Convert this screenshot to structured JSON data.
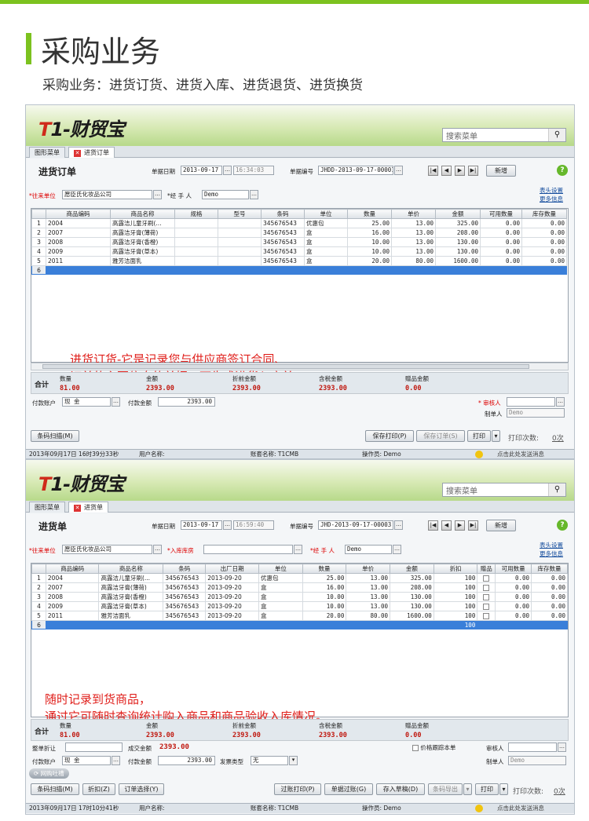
{
  "section": {
    "title": "采购业务",
    "subtitle": "采购业务：进货订货、进货入库、进货退货、进货换货"
  },
  "app": {
    "logo_t": "T",
    "logo_rest": "1-财贸宝",
    "search_placeholder": "搜索菜单",
    "search_icon": "search-icon"
  },
  "order": {
    "tabs": [
      "图形菜单",
      "进货订单"
    ],
    "title": "进货订单",
    "date_label": "单据日期",
    "date": "2013-09-17",
    "time": "16:34:03",
    "no_label": "单据编号",
    "no": "JHDD-2013-09-17-00001",
    "new_btn": "新增",
    "supplier_label": "*往来单位",
    "supplier": "愿臣氏化妆品公司",
    "handler_label": "*经 手 人",
    "handler": "Demo",
    "link1": "表头设置",
    "link2": "更多信息",
    "columns": [
      "",
      "商品编码",
      "商品名称",
      "规格",
      "型号",
      "条码",
      "单位",
      "数量",
      "单价",
      "金额",
      "可用数量",
      "库存数量"
    ],
    "rows": [
      [
        "1",
        "2004",
        "高露洁儿童牙刷(...",
        "",
        "",
        "345676543",
        "优惠包",
        "25.00",
        "13.00",
        "325.00",
        "0.00",
        "0.00"
      ],
      [
        "2",
        "2007",
        "高露洁牙膏(薄荷)",
        "",
        "",
        "345676543",
        "盒",
        "16.00",
        "13.00",
        "208.00",
        "0.00",
        "0.00"
      ],
      [
        "3",
        "2008",
        "高露洁牙膏(香橙)",
        "",
        "",
        "345676543",
        "盒",
        "10.00",
        "13.00",
        "130.00",
        "0.00",
        "0.00"
      ],
      [
        "4",
        "2009",
        "高露洁牙膏(草本)",
        "",
        "",
        "345676543",
        "盒",
        "10.00",
        "13.00",
        "130.00",
        "0.00",
        "0.00"
      ],
      [
        "5",
        "2011",
        "雅芳洁面乳",
        "",
        "",
        "345676543",
        "盒",
        "20.00",
        "80.00",
        "1600.00",
        "0.00",
        "0.00"
      ]
    ],
    "new_row_no": "6",
    "note1": "进货订货-它是记录您与供应商签订合同、",
    "note2": "订单的主要信息的单据，可生成进货入库单",
    "total_label": "合计",
    "totals": [
      {
        "k": "数量",
        "v": "81.00"
      },
      {
        "k": "金额",
        "v": "2393.00"
      },
      {
        "k": "折前金额",
        "v": "2393.00"
      },
      {
        "k": "含税金额",
        "v": "2393.00"
      },
      {
        "k": "赠品金额",
        "v": "0.00"
      }
    ],
    "pay_account_label": "付款账户",
    "pay_account": "现    金",
    "pay_amount_label": "付款金额",
    "pay_amount": "2393.00",
    "auditor_label": "* 审核人",
    "maker_label": "制单人",
    "maker": "Demo",
    "btn_scan": "条码扫描(M)",
    "btn_save_print": "保存打印(P)",
    "btn_save": "保存订单(S)",
    "btn_print": "打印",
    "print_count_label": "打印次数:",
    "print_count": "0次",
    "status": {
      "datetime": "2013年09月17日  16时39分33秒",
      "user": "用户名称:",
      "account": "账套名称: T1CMB",
      "operator": "操作员: Demo",
      "msg": "点击此处发送消息"
    }
  },
  "receipt": {
    "tabs": [
      "图形菜单",
      "进货单"
    ],
    "title": "进货单",
    "date_label": "单据日期",
    "date": "2013-09-17",
    "time": "16:59:40",
    "no_label": "单据编号",
    "no": "JHD-2013-09-17-00003",
    "new_btn": "新增",
    "supplier_label": "*往来单位",
    "supplier": "愿臣氏化妆品公司",
    "warehouse_label": "*入库库房",
    "handler_label": "*经 手 人",
    "handler": "Demo",
    "link1": "表头设置",
    "link2": "更多信息",
    "columns": [
      "",
      "商品编码",
      "商品名称",
      "条码",
      "出厂日期",
      "单位",
      "数量",
      "单价",
      "金额",
      "折扣",
      "赠品",
      "可用数量",
      "库存数量"
    ],
    "rows": [
      [
        "1",
        "2004",
        "高露洁儿童牙刷(...",
        "345676543",
        "2013-09-20",
        "优惠包",
        "25.00",
        "13.00",
        "325.00",
        "100",
        "",
        "0.00",
        "0.00"
      ],
      [
        "2",
        "2007",
        "高露洁牙膏(薄荷)",
        "345676543",
        "2013-09-20",
        "盒",
        "16.00",
        "13.00",
        "208.00",
        "100",
        "",
        "0.00",
        "0.00"
      ],
      [
        "3",
        "2008",
        "高露洁牙膏(香橙)",
        "345676543",
        "2013-09-20",
        "盒",
        "10.00",
        "13.00",
        "130.00",
        "100",
        "",
        "0.00",
        "0.00"
      ],
      [
        "4",
        "2009",
        "高露洁牙膏(草本)",
        "345676543",
        "2013-09-20",
        "盒",
        "10.00",
        "13.00",
        "130.00",
        "100",
        "",
        "0.00",
        "0.00"
      ],
      [
        "5",
        "2011",
        "雅芳洁面乳",
        "345676543",
        "2013-09-20",
        "盒",
        "20.00",
        "80.00",
        "1600.00",
        "100",
        "",
        "0.00",
        "0.00"
      ]
    ],
    "new_row_no": "6",
    "new_row_discount": "100",
    "note1": "随时记录到货商品，",
    "note2": "通过它可随时查询统计购入商品和商品验收入库情况。",
    "total_label": "合计",
    "totals": [
      {
        "k": "数量",
        "v": "81.00"
      },
      {
        "k": "金额",
        "v": "2393.00"
      },
      {
        "k": "折前金额",
        "v": "2393.00"
      },
      {
        "k": "含税金额",
        "v": "2393.00"
      },
      {
        "k": "赠品金额",
        "v": "0.00"
      }
    ],
    "whole_discount_label": "整单折让",
    "deal_amount_label": "成交金额",
    "deal_amount": "2393.00",
    "price_track_label": "价格跟踪本单",
    "auditor_label": "审核人",
    "maker_label": "制单人",
    "maker": "Demo",
    "pay_account_label": "付款账户",
    "pay_account": "现    金",
    "pay_amount_label": "付款金额",
    "pay_amount": "2393.00",
    "invoice_label": "发票类型",
    "invoice": "无",
    "tag": "网购吐槽",
    "btn_scan": "条码扫描(M)",
    "btn_discount": "折扣(Z)",
    "btn_order_select": "订单选择(Y)",
    "btn_post_print": "过账打印(P)",
    "btn_post": "单据过账(G)",
    "btn_draft": "存入草稿(D)",
    "btn_export": "条码导出",
    "btn_print": "打印",
    "print_count_label": "打印次数:",
    "print_count": "0次",
    "status": {
      "datetime": "2013年09月17日  17时10分41秒",
      "user": "用户名称:",
      "account": "账套名称: T1CMB",
      "operator": "操作员: Demo",
      "msg": "点击此处发送消息"
    }
  }
}
